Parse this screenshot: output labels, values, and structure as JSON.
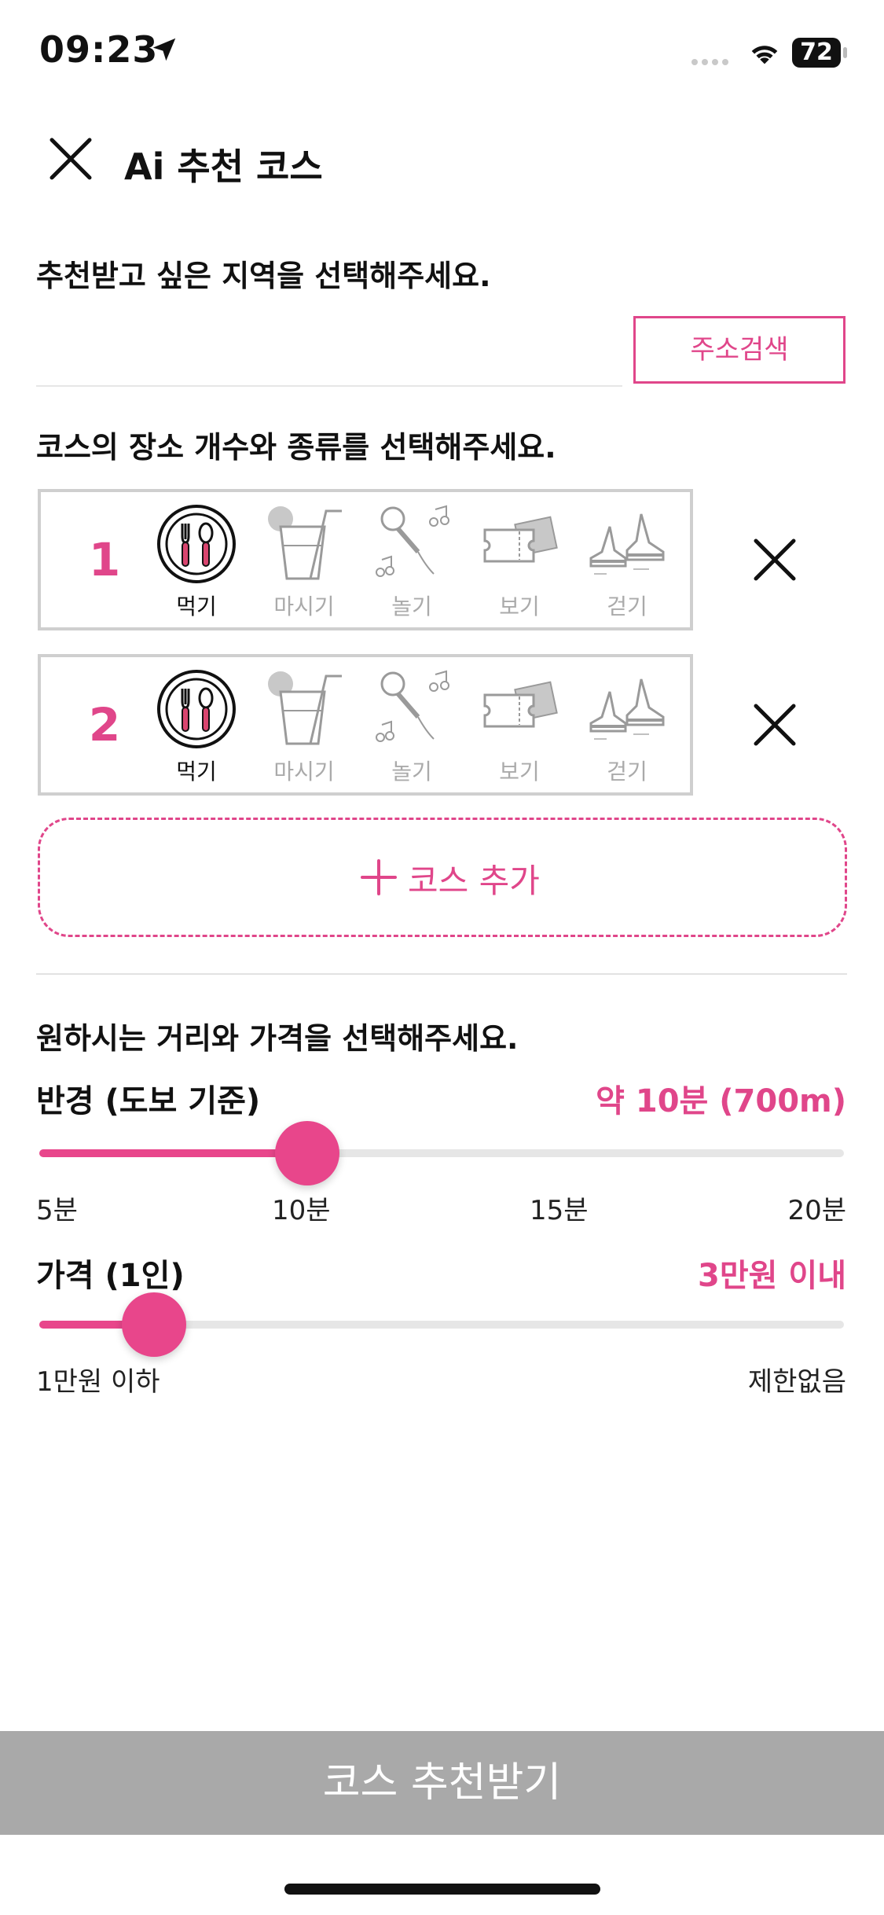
{
  "status_bar": {
    "time": "09:23",
    "battery": "72"
  },
  "header": {
    "title": "Ai 추천 코스"
  },
  "region": {
    "prompt": "추천받고 싶은 지역을 선택해주세요.",
    "address_value": "",
    "search_button": "주소검색"
  },
  "course": {
    "prompt": "코스의 장소 개수와 종류를 선택해주세요.",
    "categories": [
      "먹기",
      "마시기",
      "놀기",
      "보기",
      "걷기"
    ],
    "rows": [
      {
        "number": "1",
        "selected": "먹기"
      },
      {
        "number": "2",
        "selected": "먹기"
      }
    ],
    "add_label": "코스 추가"
  },
  "options": {
    "prompt": "원하시는 거리와 가격을 선택해주세요.",
    "radius": {
      "label": "반경 (도보 기준)",
      "value_text": "약 10분 (700m)",
      "ticks": [
        "5분",
        "10분",
        "15분",
        "20분"
      ],
      "level": 0.333
    },
    "price": {
      "label": "가격 (1인)",
      "value_text": "3만원 이내",
      "min_label": "1만원 이하",
      "max_label": "제한없음",
      "level": 0.143
    }
  },
  "submit": {
    "label": "코스 추천받기"
  },
  "colors": {
    "accent": "#e0468a",
    "disabled": "#a9a9a9",
    "border": "#cfcfcf"
  },
  "icons": [
    "location-arrow-icon",
    "wifi-icon",
    "close-icon",
    "fork-spoon-icon",
    "drink-icon",
    "microphone-icon",
    "ticket-icon",
    "shoes-icon",
    "plus-icon"
  ]
}
